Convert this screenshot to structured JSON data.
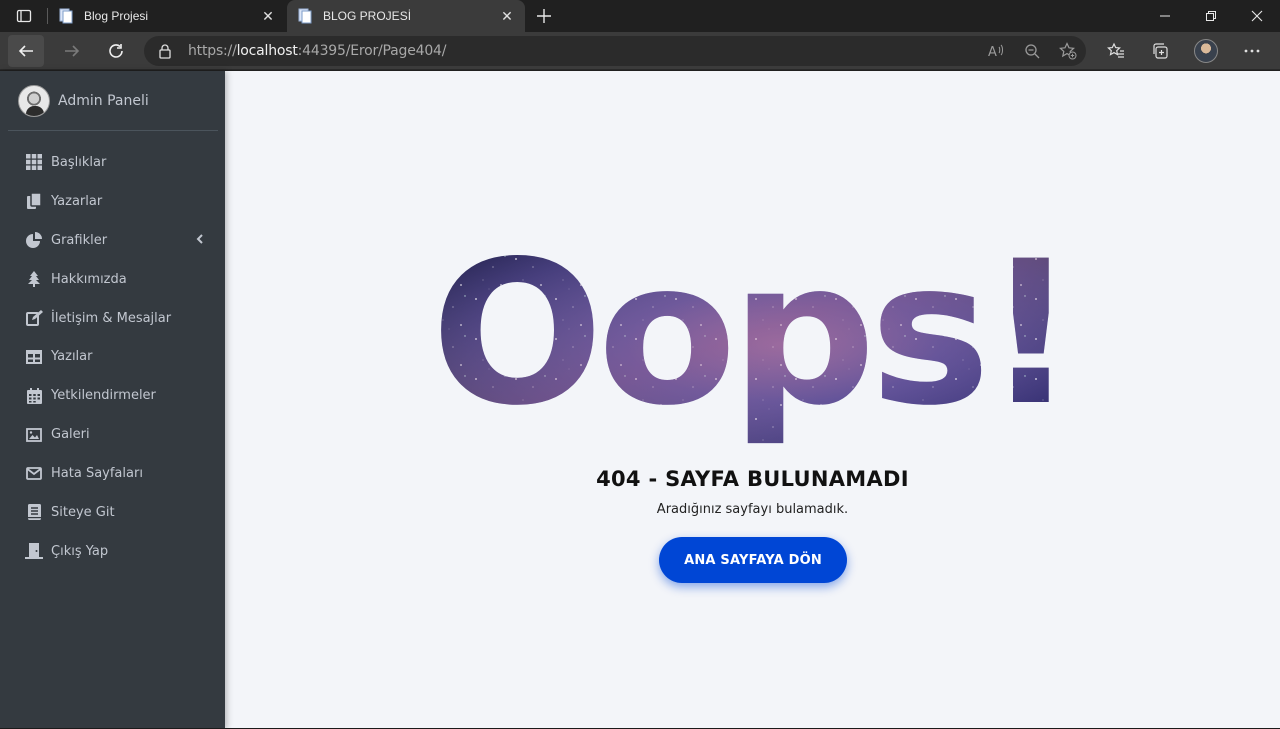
{
  "browser": {
    "tabs": [
      {
        "title": "Blog Projesi",
        "active": false
      },
      {
        "title": "BLOG PROJESİ",
        "active": true
      }
    ],
    "url_scheme": "https://",
    "url_host": "localhost",
    "url_rest": ":44395/Eror/Page404/",
    "icons": [
      "tab-actions-icon",
      "close-icon",
      "new-tab-icon",
      "minimize-icon",
      "restore-icon",
      "window-close-icon",
      "back-icon",
      "forward-icon",
      "reload-icon",
      "lock-icon",
      "read-aloud-icon",
      "zoom-out-icon",
      "add-favorite-icon",
      "favorites-icon",
      "collections-icon",
      "profile-avatar",
      "more-icon"
    ]
  },
  "sidebar": {
    "user_name": "Admin Paneli",
    "items": [
      {
        "label": "Başlıklar",
        "icon": "grid-icon"
      },
      {
        "label": "Yazarlar",
        "icon": "copy-icon"
      },
      {
        "label": "Grafikler",
        "icon": "pie-chart-icon",
        "has_children": true
      },
      {
        "label": "Hakkımızda",
        "icon": "tree-icon"
      },
      {
        "label": "İletişim & Mesajlar",
        "icon": "edit-icon"
      },
      {
        "label": "Yazılar",
        "icon": "table-icon"
      },
      {
        "label": "Yetkilendirmeler",
        "icon": "calendar-icon"
      },
      {
        "label": "Galeri",
        "icon": "image-icon"
      },
      {
        "label": "Hata Sayfaları",
        "icon": "envelope-icon"
      },
      {
        "label": "Siteye Git",
        "icon": "book-icon"
      },
      {
        "label": "Çıkış Yap",
        "icon": "door-icon"
      }
    ]
  },
  "error_page": {
    "headline": "Oops!",
    "title": "404 - SAYFA BULUNAMADI",
    "subtitle": "Aradığınız sayfayı bulamadık.",
    "button_label": "ANA SAYFAYA DÖN"
  },
  "colors": {
    "sidebar_bg": "#343a40",
    "page_bg": "#f3f5f9",
    "button_bg": "#0046d5"
  }
}
